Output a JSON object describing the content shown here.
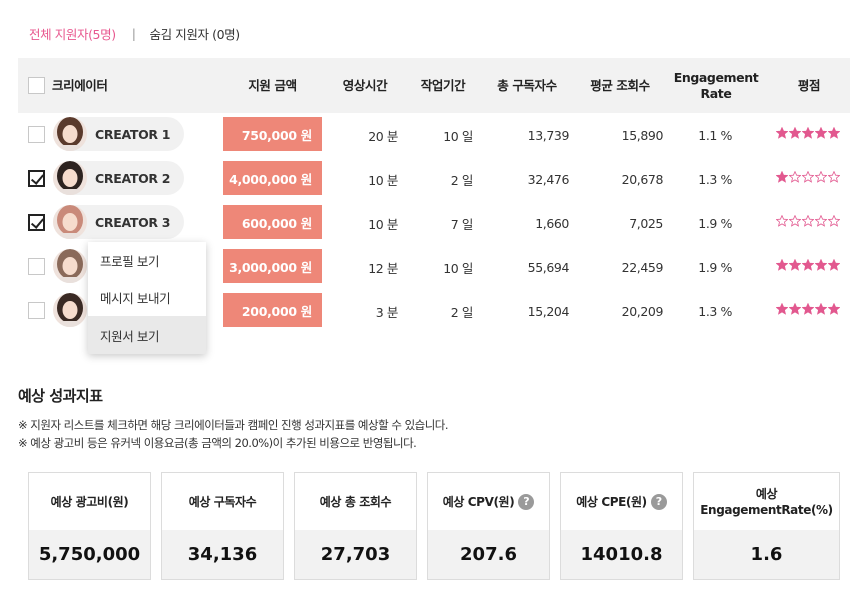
{
  "tabs": {
    "all": "전체 지원자(5명)",
    "separator": "|",
    "hidden": "숨김 지원자 (0명)"
  },
  "table": {
    "headers": {
      "creator": "크리에이터",
      "amount": "지원 금액",
      "video_time": "영상시간",
      "work_period": "작업기간",
      "subscribers": "총 구독자수",
      "avg_views": "평균 조회수",
      "engagement": "Engagement Rate",
      "rating": "평점"
    },
    "rows": [
      {
        "name": "CREATOR 1",
        "amount": "750,000 원",
        "video_time": "20 분",
        "work_period": "10 일",
        "subscribers": "13,739",
        "avg_views": "15,890",
        "engagement": "1.1 %",
        "rating": 5,
        "checked": false
      },
      {
        "name": "CREATOR 2",
        "amount": "4,000,000 원",
        "video_time": "10 분",
        "work_period": "2 일",
        "subscribers": "32,476",
        "avg_views": "20,678",
        "engagement": "1.3 %",
        "rating": 1,
        "checked": true
      },
      {
        "name": "CREATOR 3",
        "amount": "600,000 원",
        "video_time": "10 분",
        "work_period": "7 일",
        "subscribers": "1,660",
        "avg_views": "7,025",
        "engagement": "1.9 %",
        "rating": 0,
        "checked": true
      },
      {
        "name": "",
        "amount": "3,000,000 원",
        "video_time": "12 분",
        "work_period": "10 일",
        "subscribers": "55,694",
        "avg_views": "22,459",
        "engagement": "1.9 %",
        "rating": 5,
        "checked": false
      },
      {
        "name": "",
        "amount": "200,000 원",
        "video_time": "3 분",
        "work_period": "2 일",
        "subscribers": "15,204",
        "avg_views": "20,209",
        "engagement": "1.3 %",
        "rating": 5,
        "checked": false
      }
    ]
  },
  "context_menu": {
    "items": [
      "프로필 보기",
      "메시지 보내기",
      "지원서 보기"
    ]
  },
  "performance": {
    "title": "예상 성과지표",
    "notes": [
      "※ 지원자 리스트를 체크하면 해당 크리에이터들과 캠페인 진행 성과지표를 예상할 수 있습니다.",
      "※ 예상 광고비 등은 유커넥 이용요금(총 금액의 20.0%)이 추가된 비용으로 반영됩니다."
    ],
    "cards": [
      {
        "label": "예상 광고비(원)",
        "value": "5,750,000"
      },
      {
        "label": "예상 구독자수",
        "value": "34,136"
      },
      {
        "label": "예상 총 조회수",
        "value": "27,703"
      },
      {
        "label": "예상 CPV(원)",
        "value": "207.6",
        "help": "?"
      },
      {
        "label": "예상 CPE(원)",
        "value": "14010.8",
        "help": "?"
      },
      {
        "label_line1": "예상",
        "label_line2": "EngagementRate(%)",
        "value": "1.6"
      }
    ]
  },
  "colors": {
    "accent_pink": "#e8588f",
    "amount_bg": "#ee8778",
    "star": "#e2588f",
    "header_bg": "#f2f2f2"
  },
  "icons": {
    "checkbox": "checkbox-icon",
    "star": "star-icon",
    "help": "question-circle-icon",
    "avatar": "avatar-image"
  }
}
